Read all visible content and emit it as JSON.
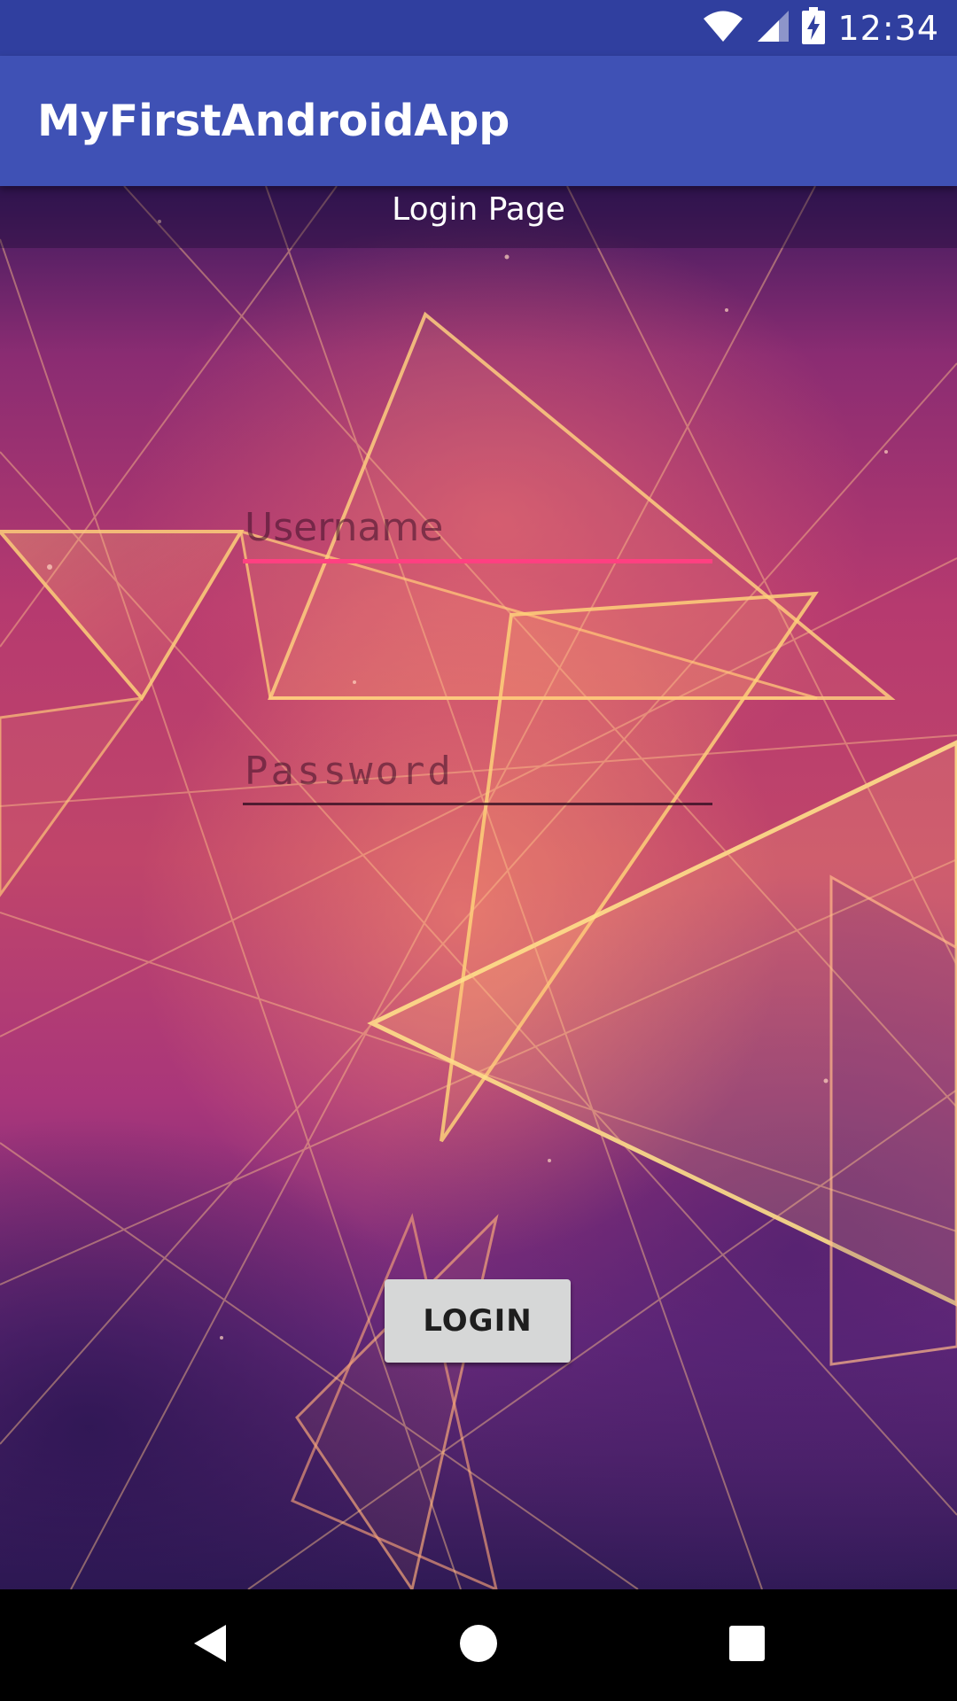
{
  "status_bar": {
    "time": "12:34",
    "icons": [
      "wifi-icon",
      "signal-icon",
      "battery-charging-icon"
    ]
  },
  "app_bar": {
    "title": "MyFirstAndroidApp"
  },
  "login_form": {
    "heading": "Login Page",
    "username": {
      "value": "",
      "placeholder": "Username"
    },
    "password": {
      "value": "",
      "placeholder": "Password"
    },
    "login_label": "LOGIN"
  },
  "nav_bar": {
    "icons": [
      "back-icon",
      "home-icon",
      "recents-icon"
    ]
  },
  "colors": {
    "status_bar": "#303f9f",
    "app_bar": "#3f51b5",
    "accent": "#ff4081",
    "button": "#d6d7d7"
  }
}
